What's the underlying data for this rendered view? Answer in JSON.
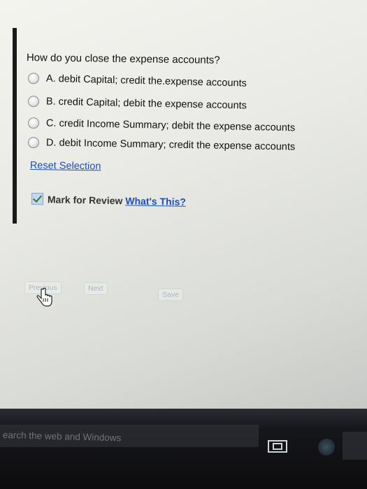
{
  "question": {
    "text": "How do you close the expense accounts?",
    "options": [
      {
        "label": "A. debit Capital; credit the.expense accounts"
      },
      {
        "label": "B. credit Capital; debit the expense accounts"
      },
      {
        "label": "C. credit Income Summary; debit the expense accounts"
      },
      {
        "label": "D. debit Income Summary; credit the expense accounts"
      }
    ]
  },
  "reset_label": "Reset Selection",
  "review": {
    "label": "Mark for Review",
    "link": "What's This?",
    "checked": true
  },
  "nav": {
    "previous": "Previous",
    "next": "Next",
    "save": "Save"
  },
  "taskbar": {
    "search_text": "earch the web and Windows"
  },
  "colors": {
    "link": "#1e4fb3",
    "taskbar": "#121317"
  },
  "icons": [
    "radio-button-icon",
    "checkbox-check-icon",
    "hand-cursor-icon",
    "task-view-icon"
  ]
}
